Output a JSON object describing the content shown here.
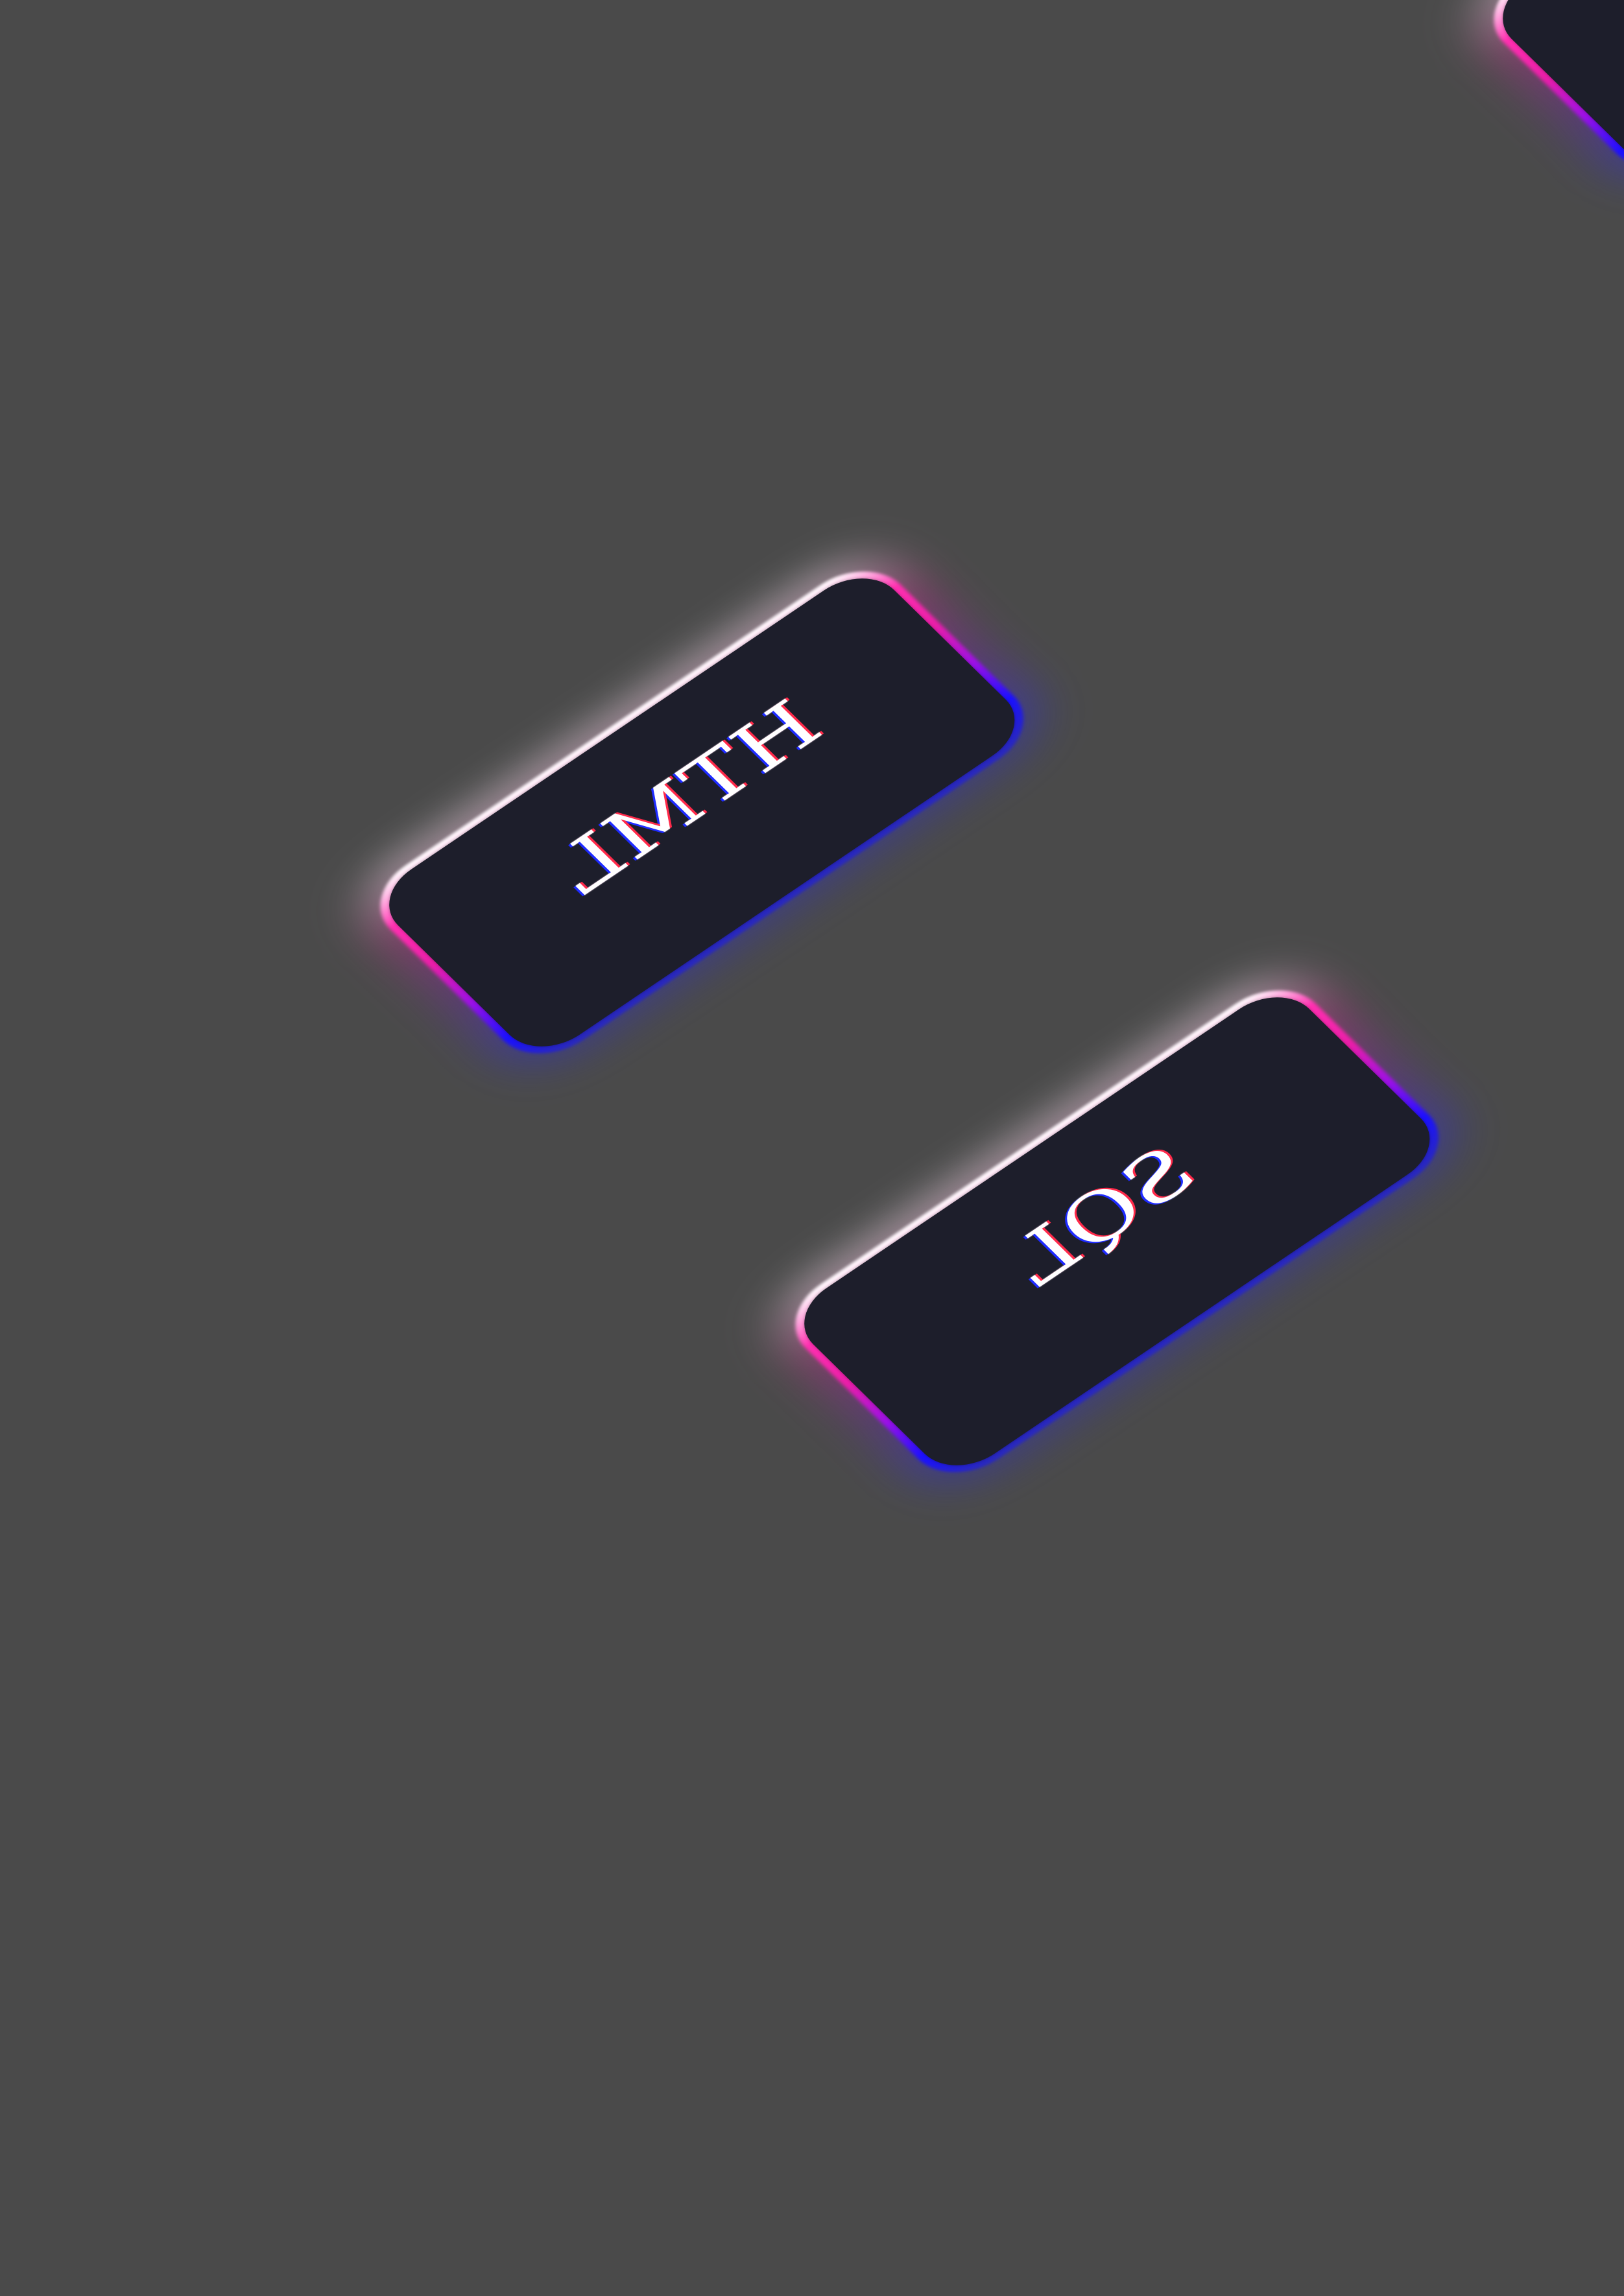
{
  "cards": [
    {
      "label": "HTML"
    },
    {
      "label": "SQL"
    },
    {
      "label": ""
    }
  ],
  "colors": {
    "background": "#4a4a4a",
    "card_face": "#1d1e2b",
    "edge_top": "#ff2fb0",
    "edge_bottom": "#1a10ff",
    "text": "#ffffff"
  }
}
